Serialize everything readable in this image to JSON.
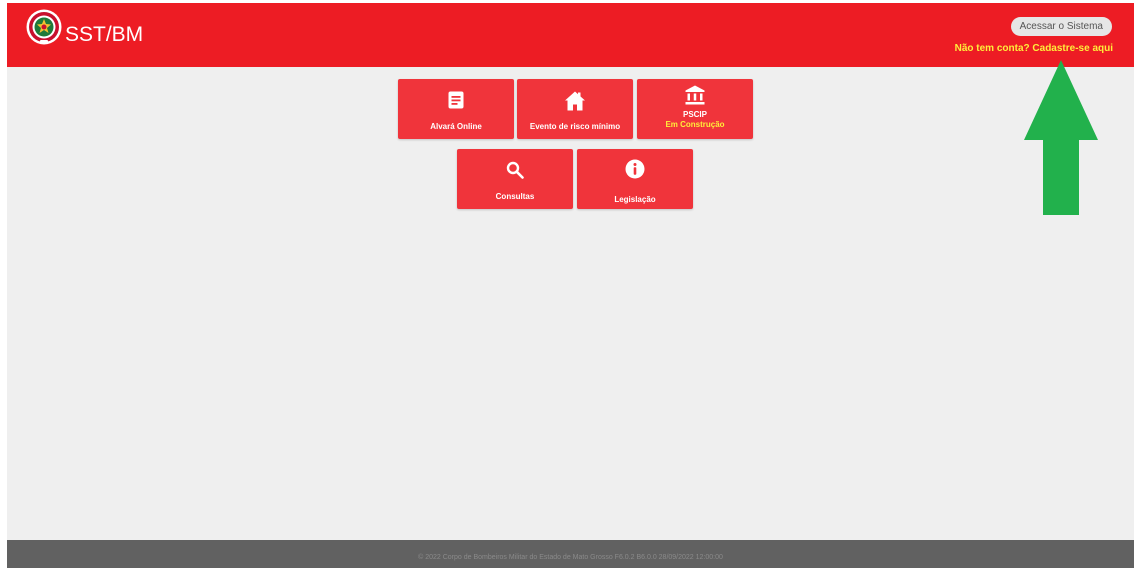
{
  "header": {
    "app_title": "SST/BM",
    "login_label": "Acessar o Sistema",
    "signup_label": "Não tem conta? Cadastre-se aqui",
    "logo_icon": "fire-department-emblem-icon"
  },
  "tiles": [
    {
      "label": "Alvará Online",
      "icon": "document-icon"
    },
    {
      "label": "Evento de risco mínimo",
      "icon": "house-icon"
    },
    {
      "label": "PSCIP",
      "sub_label": "Em Construção",
      "icon": "bank-icon"
    },
    {
      "label": "Consultas",
      "icon": "search-icon"
    },
    {
      "label": "Legislação",
      "icon": "info-icon"
    }
  ],
  "footer": {
    "text": "© 2022 Corpo de Bombeiros Militar do Estado de Mato Grosso F6.0.2 B6.0.0 28/09/2022 12:00:00"
  },
  "colors": {
    "header_bg": "#ed1c24",
    "tile_bg": "#f0343b",
    "accent_yellow": "#ffee3a",
    "content_bg": "#efefef",
    "footer_bg": "#616161",
    "overlay_arrow": "#22b14c"
  }
}
